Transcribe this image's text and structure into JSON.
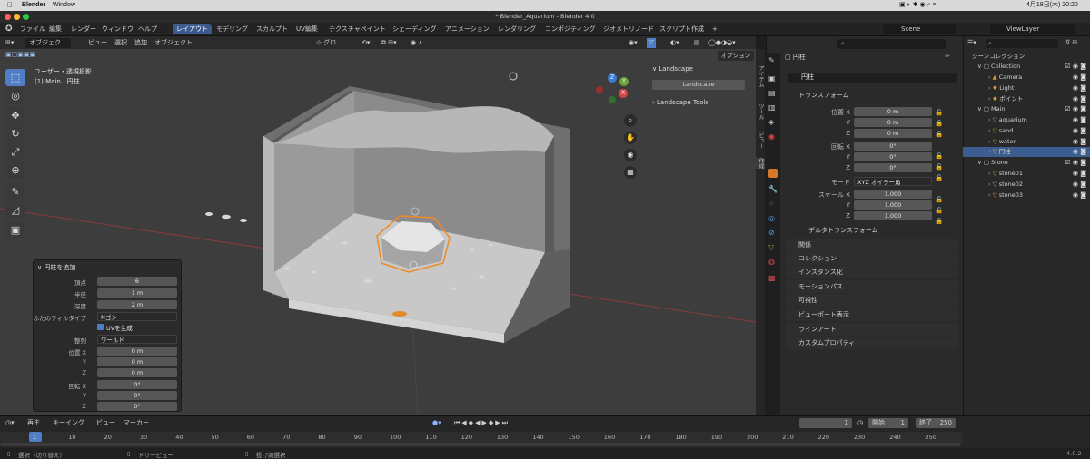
{
  "mac_menu": {
    "app": "Blender",
    "window": "Window",
    "clock": "4月18日(木) 20:20"
  },
  "window_title": "* Blender_Aquarium - Blender 4.0",
  "top_menu": [
    "ファイル",
    "編集",
    "レンダー",
    "ウィンドウ",
    "ヘルプ"
  ],
  "workspaces": [
    "レイアウト",
    "モデリング",
    "スカルプト",
    "UV編集",
    "テクスチャペイント",
    "シェーディング",
    "アニメーション",
    "レンダリング",
    "コンポジティング",
    "ジオメトリノード",
    "スクリプト作成"
  ],
  "active_workspace": "レイアウト",
  "scene_name": "Scene",
  "view_layer": "ViewLayer",
  "viewport_header": {
    "mode": "オブジェク…",
    "menus": [
      "ビュー",
      "選択",
      "追加",
      "オブジェクト"
    ],
    "transform_orientation": "グロ…",
    "options": "オプション"
  },
  "viewport_overlay_text": {
    "line1": "ユーザー・透視投影",
    "line2": "(1) Main | 円柱"
  },
  "gizmo_axes": {
    "x": "X",
    "y": "Y",
    "z": "Z"
  },
  "landscape_panel": {
    "title": "Landscape",
    "button": "Landscape",
    "tools": "Landscape Tools"
  },
  "n_panel_tabs": [
    "アイテム",
    "ツール",
    "ビュー",
    "作成"
  ],
  "operator_panel": {
    "title": "円柱を追加",
    "fields": [
      {
        "label": "頂点",
        "value": "6"
      },
      {
        "label": "半径",
        "value": "1 m"
      },
      {
        "label": "深度",
        "value": "2 m"
      },
      {
        "label": "ふたのフィルタイプ",
        "value": "Nゴン"
      },
      {
        "label": "",
        "value": "UVを生成"
      },
      {
        "label": "整列",
        "value": "ワールド"
      },
      {
        "label": "位置 X",
        "value": "0 m"
      },
      {
        "label": "Y",
        "value": "0 m"
      },
      {
        "label": "Z",
        "value": "0 m"
      },
      {
        "label": "回転 X",
        "value": "0°"
      },
      {
        "label": "Y",
        "value": "0°"
      },
      {
        "label": "Z",
        "value": "0°"
      }
    ]
  },
  "properties": {
    "object_name": "円柱",
    "object_name_field": "円柱",
    "transform_title": "トランスフォーム",
    "location": [
      {
        "label": "位置 X",
        "value": "0 m"
      },
      {
        "label": "Y",
        "value": "0 m"
      },
      {
        "label": "Z",
        "value": "0 m"
      }
    ],
    "rotation": [
      {
        "label": "回転 X",
        "value": "0°"
      },
      {
        "label": "Y",
        "value": "0°"
      },
      {
        "label": "Z",
        "value": "0°"
      }
    ],
    "mode_label": "モード",
    "mode_value": "XYZ オイラー角",
    "scale": [
      {
        "label": "スケール X",
        "value": "1.000"
      },
      {
        "label": "Y",
        "value": "1.000"
      },
      {
        "label": "Z",
        "value": "1.000"
      }
    ],
    "delta": "デルタトランスフォーム",
    "sections": [
      "関係",
      "コレクション",
      "インスタンス化",
      "モーションパス",
      "可視性",
      "ビューポート表示",
      "ラインアート",
      "カスタムプロパティ"
    ]
  },
  "outliner": {
    "title": "シーンコレクション",
    "rows": [
      {
        "name": "Collection",
        "indent": 1,
        "selected": false
      },
      {
        "name": "Camera",
        "indent": 2,
        "selected": false
      },
      {
        "name": "Light",
        "indent": 2,
        "selected": false
      },
      {
        "name": "ポイント",
        "indent": 2,
        "selected": false
      },
      {
        "name": "Main",
        "indent": 1,
        "selected": false
      },
      {
        "name": "aquarium",
        "indent": 2,
        "selected": false
      },
      {
        "name": "sand",
        "indent": 2,
        "selected": false
      },
      {
        "name": "water",
        "indent": 2,
        "selected": false
      },
      {
        "name": "円柱",
        "indent": 2,
        "selected": true
      },
      {
        "name": "Stone",
        "indent": 1,
        "selected": false
      },
      {
        "name": "stone01",
        "indent": 2,
        "selected": false
      },
      {
        "name": "stone02",
        "indent": 2,
        "selected": false
      },
      {
        "name": "stone03",
        "indent": 2,
        "selected": false
      }
    ]
  },
  "timeline": {
    "menus": [
      "再生",
      "キーイング",
      "ビュー",
      "マーカー"
    ],
    "current_frame": "1",
    "start_label": "開始",
    "start": "1",
    "end_label": "終了",
    "end": "250",
    "ticks": [
      "1",
      "10",
      "20",
      "30",
      "40",
      "50",
      "60",
      "70",
      "80",
      "90",
      "100",
      "110",
      "120",
      "130",
      "140",
      "150",
      "160",
      "170",
      "180",
      "190",
      "200",
      "210",
      "220",
      "230",
      "240",
      "250"
    ]
  },
  "status_bar": {
    "select": "選択（切り替え）",
    "dolly": "ドリービュー",
    "lasso": "投げ縄選択",
    "version": "4.0.2"
  }
}
